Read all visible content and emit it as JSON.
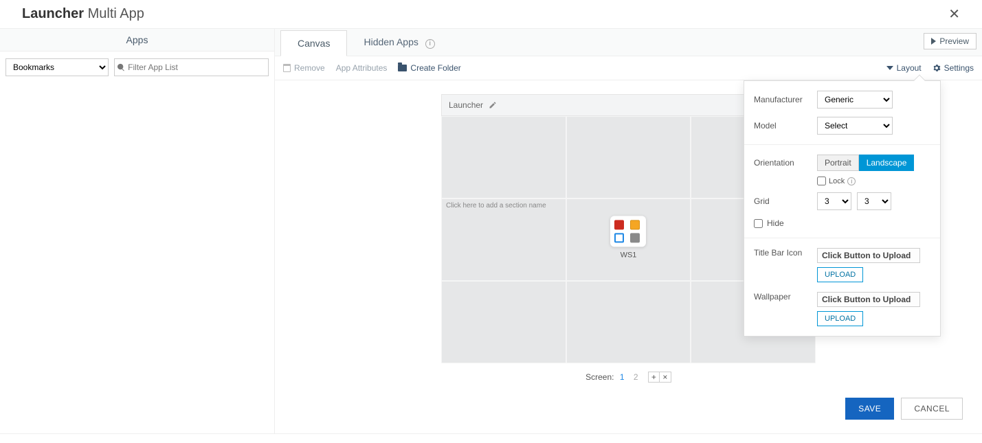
{
  "header": {
    "title_bold": "Launcher",
    "title_light": "Multi App"
  },
  "sidebar": {
    "apps_header": "Apps",
    "bookmark_select": "Bookmarks",
    "filter_placeholder": "Filter App List"
  },
  "tabs": {
    "canvas": "Canvas",
    "hidden": "Hidden Apps"
  },
  "preview": "Preview",
  "actions": {
    "remove": "Remove",
    "app_attrs": "App Attributes",
    "create_folder": "Create Folder",
    "layout": "Layout",
    "settings": "Settings"
  },
  "canvas": {
    "launcher_label": "Launcher",
    "section_hint": "Click here to add a section name",
    "folder_name": "WS1",
    "screen_label": "Screen:",
    "pages": [
      "1",
      "2"
    ]
  },
  "layout": {
    "manufacturer_label": "Manufacturer",
    "manufacturer_value": "Generic",
    "model_label": "Model",
    "model_value": "Select",
    "orientation_label": "Orientation",
    "orient_portrait": "Portrait",
    "orient_landscape": "Landscape",
    "lock_label": "Lock",
    "grid_label": "Grid",
    "grid_cols": "3",
    "grid_rows": "3",
    "hide_label": "Hide",
    "titlebar_label": "Title Bar Icon",
    "upload_placeholder": "Click Button to Upload",
    "upload_btn": "UPLOAD",
    "wallpaper_label": "Wallpaper"
  },
  "footer": {
    "save": "SAVE",
    "cancel": "CANCEL"
  }
}
